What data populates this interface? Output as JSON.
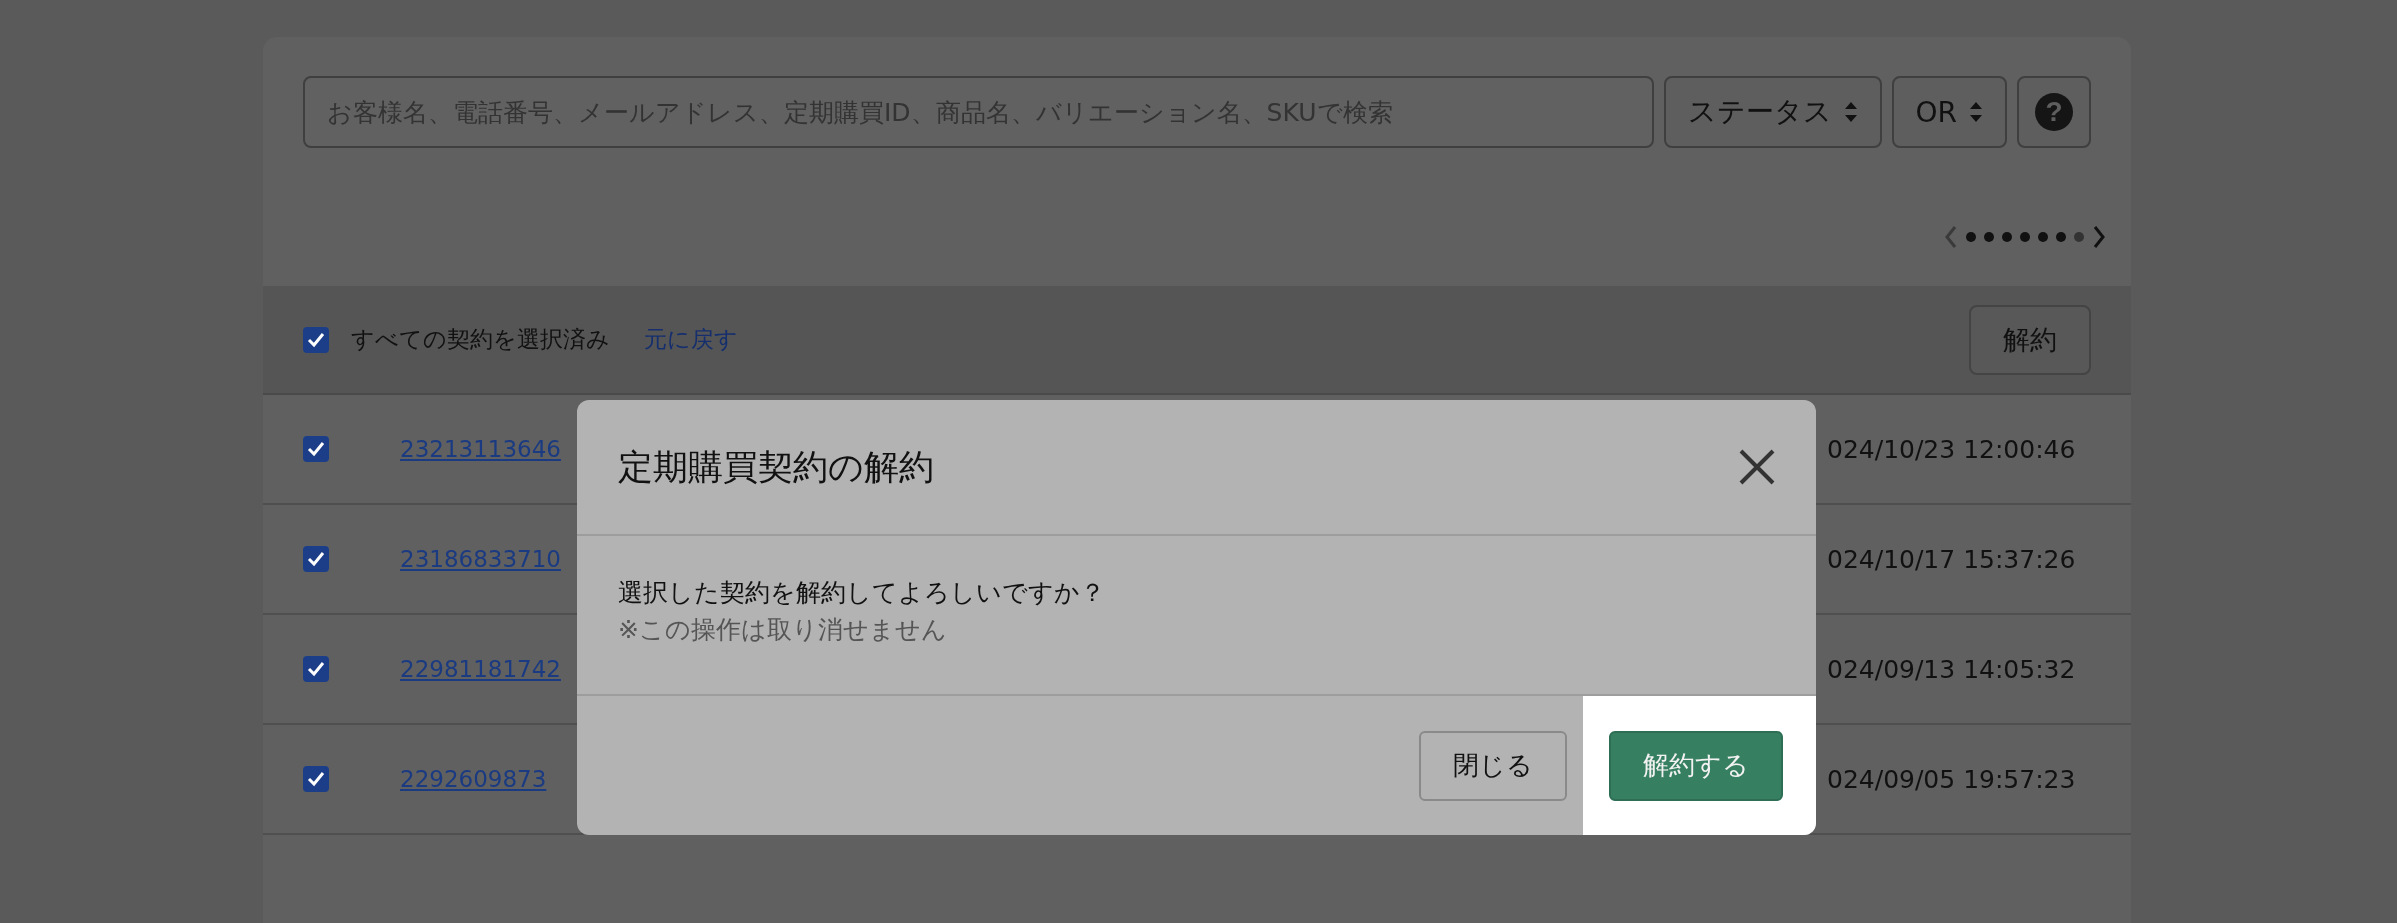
{
  "search": {
    "placeholder": "お客様名、電話番号、メールアドレス、定期購買ID、商品名、バリエーション名、SKUで検索"
  },
  "filters": [
    {
      "label": "ステータス"
    },
    {
      "label": "OR"
    }
  ],
  "help_button": {
    "label": "?"
  },
  "pagination": {
    "prev_disabled": true,
    "next_disabled": false,
    "dots": [
      {
        "filled": true
      },
      {
        "filled": true
      },
      {
        "filled": true
      },
      {
        "filled": true
      },
      {
        "filled": true
      },
      {
        "filled": true
      },
      {
        "filled": false
      }
    ]
  },
  "bulk_bar": {
    "checked": true,
    "label": "すべての契約を選択済み",
    "undo_link": "元に戻す",
    "action_button": "解約"
  },
  "rows": [
    {
      "checked": true,
      "id": "23213113646",
      "date": "024/10/23 12:00:46"
    },
    {
      "checked": true,
      "id": "23186833710",
      "date": "024/10/17 15:37:26"
    },
    {
      "checked": true,
      "id": "22981181742",
      "date": "024/09/13 14:05:32"
    },
    {
      "checked": true,
      "id": "2292609873",
      "date": "024/09/05 19:57:23"
    }
  ],
  "modal": {
    "title": "定期購買契約の解約",
    "message": "選択した契約を解約してよろしいですか？",
    "note": "※この操作は取り消せません",
    "buttons": [
      {
        "label": "閉じる",
        "kind": "secondary"
      },
      {
        "label": "解約する",
        "kind": "primary",
        "highlighted": true
      }
    ]
  }
}
